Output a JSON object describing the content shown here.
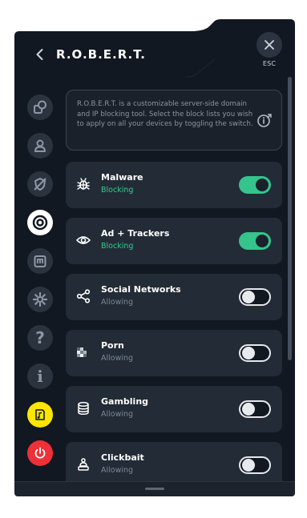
{
  "header": {
    "title": "R.O.B.E.R.T.",
    "esc_label": "ESC"
  },
  "sidebar": {
    "items": [
      {
        "icon": "shapes-icon",
        "state": "default"
      },
      {
        "icon": "user-icon",
        "state": "default"
      },
      {
        "icon": "shield-slash-icon",
        "state": "default"
      },
      {
        "icon": "robert-icon",
        "state": "active"
      },
      {
        "icon": "storage-icon",
        "state": "default"
      },
      {
        "icon": "gear-icon",
        "state": "default"
      },
      {
        "icon": "help-icon",
        "glyph": "?",
        "state": "default"
      },
      {
        "icon": "info-icon",
        "glyph": "i",
        "state": "default"
      },
      {
        "icon": "music-file-icon",
        "state": "yellow"
      },
      {
        "icon": "power-icon",
        "state": "red"
      }
    ]
  },
  "info": {
    "text": "R.O.B.E.R.T. is a customizable server-side domain and IP blocking tool. Select the block lists you wish to apply on all your devices by toggling the switch."
  },
  "lists": [
    {
      "name": "Malware",
      "status": "Blocking",
      "enabled": true,
      "icon": "bug-icon"
    },
    {
      "name": "Ad + Trackers",
      "status": "Blocking",
      "enabled": true,
      "icon": "eye-icon"
    },
    {
      "name": "Social Networks",
      "status": "Allowing",
      "enabled": false,
      "icon": "share-icon"
    },
    {
      "name": "Porn",
      "status": "Allowing",
      "enabled": false,
      "icon": "pixelated-icon"
    },
    {
      "name": "Gambling",
      "status": "Allowing",
      "enabled": false,
      "icon": "coins-icon"
    },
    {
      "name": "Clickbait",
      "status": "Allowing",
      "enabled": false,
      "icon": "bait-icon"
    }
  ],
  "colors": {
    "accent_green": "#34c48c",
    "status_green": "#2fd08f",
    "panel_bg": "#121821",
    "card_bg": "#222b36",
    "yellow": "#ffe600",
    "red": "#ee3038"
  }
}
